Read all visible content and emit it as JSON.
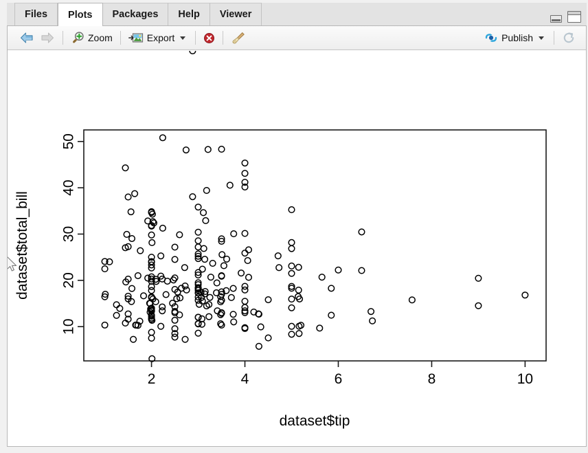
{
  "window": {
    "minimize_label": "minimize",
    "maximize_label": "maximize"
  },
  "tabs": [
    {
      "label": "Files",
      "active": false
    },
    {
      "label": "Plots",
      "active": true
    },
    {
      "label": "Packages",
      "active": false
    },
    {
      "label": "Help",
      "active": false
    },
    {
      "label": "Viewer",
      "active": false
    }
  ],
  "toolbar": {
    "back_label": "",
    "forward_label": "",
    "zoom_label": "Zoom",
    "export_label": "Export",
    "remove_label": "",
    "clear_label": "",
    "publish_label": "Publish",
    "refresh_label": "",
    "icons": {
      "back": "left-arrow-icon",
      "forward": "right-arrow-icon",
      "zoom": "magnifier-plus-icon",
      "export": "export-image-icon",
      "remove": "remove-plot-icon",
      "clear": "broom-icon",
      "publish": "publish-icon",
      "refresh": "refresh-icon"
    }
  },
  "colors": {
    "accent": "#1a8cd8",
    "danger": "#c0272d",
    "point_stroke": "#000000",
    "axis": "#1a1a1a",
    "tab_active_bg": "#ffffff",
    "tab_bg": "#e3e3e3",
    "toolbar_bg": "#f3f3f3"
  },
  "chart_data": {
    "type": "scatter",
    "title": "",
    "xlabel": "dataset$tip",
    "ylabel": "dataset$total_bill",
    "xlim": [
      0.55,
      10.45
    ],
    "ylim": [
      2.6,
      52.5
    ],
    "xticks": [
      2,
      4,
      6,
      8,
      10
    ],
    "yticks": [
      10,
      20,
      30,
      40,
      50
    ],
    "grid": false,
    "legend": null,
    "marker": "open-circle",
    "n_points": 244,
    "x": [
      1.01,
      1.66,
      3.5,
      3.31,
      3.61,
      4.71,
      2,
      3.12,
      1.96,
      3.23,
      1.71,
      5,
      1.57,
      3,
      3.02,
      3.92,
      1.67,
      3.71,
      3.5,
      4.08,
      2.75,
      2.23,
      7.58,
      3.18,
      2.34,
      2,
      2,
      4.3,
      3,
      1.45,
      2.5,
      3,
      2.45,
      3.27,
      3.6,
      2,
      3.07,
      2.31,
      5,
      2.24,
      2.54,
      3.06,
      1.32,
      5.6,
      3,
      5,
      6,
      2.05,
      3,
      2.5,
      2.6,
      5.2,
      1.56,
      4.34,
      3.51,
      3,
      1.5,
      1.76,
      6.73,
      3.21,
      2,
      1.98,
      3.76,
      2.64,
      3.15,
      2.47,
      1,
      2.01,
      2.09,
      1.97,
      3,
      3.14,
      5,
      2.2,
      1.25,
      3.08,
      4,
      3,
      2.71,
      3,
      3.4,
      1.83,
      5,
      2.03,
      5.17,
      2,
      4,
      5.85,
      3,
      3,
      3.5,
      1,
      4.3,
      3.25,
      4.73,
      4,
      1.5,
      3,
      1.71,
      5.85,
      2.01,
      2.09,
      1.44,
      3.09,
      2.2,
      3.48,
      1.92,
      3,
      1.58,
      2.5,
      2,
      2.72,
      2.88,
      2,
      3,
      3.39,
      1.47,
      3,
      1.25,
      1,
      3.08,
      4,
      2.23,
      5,
      2,
      2,
      5.16,
      9,
      2.5,
      5.15,
      3,
      1.5,
      1.75,
      2,
      3.75,
      2.5,
      3.5,
      4,
      1.5,
      4.19,
      2.56,
      2.02,
      4,
      1.44,
      2,
      5,
      2,
      2,
      4,
      2,
      5,
      1.97,
      3,
      3.14,
      2.1,
      2.6,
      2.74,
      2,
      2,
      5.14,
      5,
      3.75,
      2.61,
      2,
      3.5,
      2.5,
      2,
      2,
      3,
      3.48,
      2.24,
      4.5,
      1.61,
      2,
      10,
      3.16,
      5.15,
      3.18,
      4,
      3.11,
      2,
      2,
      4,
      3.55,
      3.68,
      5.65,
      3.5,
      6.5,
      3,
      5,
      3.5,
      2,
      3.5,
      4,
      1.5,
      4.5,
      1,
      4,
      3.5,
      2,
      4,
      1.5,
      2.5,
      3,
      2.5,
      3.48,
      4.08,
      1.64,
      4.06,
      4.29,
      3.76,
      4,
      3.5,
      6.7,
      5,
      3.5,
      2.01,
      2,
      2.5,
      4,
      3.23,
      3.41,
      3,
      2.03,
      2.23,
      2,
      5.16,
      9,
      2.5,
      6.5,
      1.1,
      3,
      1.5,
      1.44,
      3.09,
      2.2,
      3.48,
      1.92,
      3,
      1.58,
      2.5,
      2,
      3,
      2.72,
      2.88
    ],
    "y": [
      16.99,
      10.34,
      21.01,
      23.68,
      24.59,
      25.29,
      8.77,
      26.88,
      15.04,
      14.78,
      10.27,
      35.26,
      15.42,
      18.43,
      14.83,
      21.58,
      10.33,
      16.29,
      16.97,
      20.65,
      17.92,
      20.29,
      15.77,
      39.42,
      19.82,
      17.81,
      13.37,
      12.69,
      21.7,
      19.65,
      9.55,
      18.35,
      15.06,
      20.69,
      17.78,
      24.06,
      16.31,
      16.93,
      18.69,
      31.27,
      16.04,
      17.46,
      13.94,
      9.68,
      30.4,
      18.29,
      22.23,
      32.4,
      28.55,
      18.04,
      12.54,
      10.29,
      34.81,
      9.94,
      25.56,
      19.49,
      38.01,
      26.41,
      11.24,
      48.27,
      20.29,
      13.81,
      11.02,
      18.29,
      17.59,
      20.08,
      16.45,
      3.07,
      20.23,
      15.01,
      12.02,
      17.07,
      26.86,
      25.28,
      14.73,
      10.51,
      17.92,
      27.2,
      22.76,
      17.29,
      19.44,
      16.66,
      10.07,
      32.68,
      15.98,
      34.83,
      13.03,
      18.28,
      24.71,
      21.16,
      28.97,
      22.49,
      5.75,
      16.32,
      22.75,
      40.17,
      27.28,
      12.03,
      21.01,
      12.46,
      11.35,
      15.38,
      44.3,
      22.42,
      20.92,
      15.36,
      20.49,
      25.21,
      18.24,
      14.31,
      14,
      7.25,
      38.07,
      23.95,
      25.71,
      17.31,
      29.93,
      10.65,
      12.43,
      24.08,
      11.69,
      13.42,
      14.26,
      15.95,
      12.48,
      29.8,
      8.52,
      14.52,
      11.38,
      22.82,
      19.08,
      20.27,
      11.17,
      12.26,
      18.26,
      8.51,
      10.33,
      14.15,
      16,
      13.16,
      17.47,
      34.3,
      41.19,
      27.05,
      16.43,
      8.35,
      18.64,
      11.87,
      9.78,
      7.51,
      14.07,
      13.13,
      17.26,
      24.55,
      19.77,
      29.85,
      48.17,
      25,
      13.39,
      16.49,
      21.5,
      12.66,
      16.21,
      13.81,
      17.51,
      24.52,
      20.76,
      31.71,
      10.59,
      10.63,
      50.81,
      15.81,
      7.25,
      31.85,
      16.82,
      32.9,
      17.89,
      14.48,
      9.6,
      34.63,
      34.65,
      23.33,
      45.35,
      23.17,
      40.55,
      20.69,
      20.9,
      30.46,
      18.15,
      23.1,
      15.69,
      19.81,
      28.44,
      15.48,
      16.58,
      7.56,
      10.34,
      43.11,
      13,
      13.51,
      18.71,
      12.74,
      13,
      16.4,
      20.53,
      16.47,
      26.59,
      38.73,
      24.27,
      12.76,
      30.06,
      25.89,
      48.33,
      13.27,
      28.17,
      12.9,
      28.15,
      11.59,
      7.74,
      30.14,
      12.16,
      13.42,
      8.58,
      15.98,
      13.42,
      16.27,
      10.09,
      20.45,
      13.28,
      22.12,
      24.01,
      15.69,
      11.61,
      10.77,
      15.53,
      10.07,
      12.6,
      32.83,
      35.83,
      29.03,
      27.18,
      22.67,
      17.82,
      18.78
    ]
  }
}
